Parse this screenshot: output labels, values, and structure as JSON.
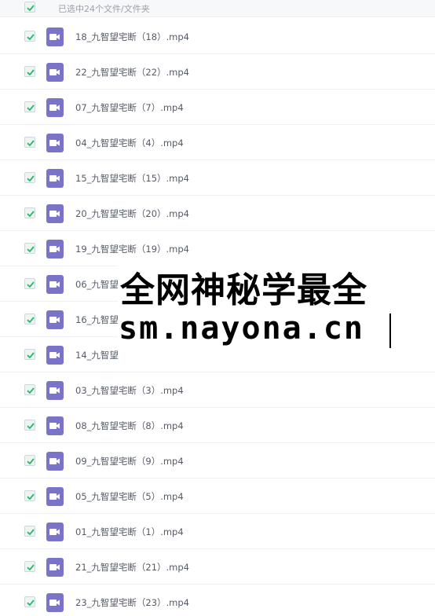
{
  "header": {
    "summary": "已选中24个文件/文件夹",
    "select_all_checked": true
  },
  "files": [
    {
      "name": "18_九智望宅断（18）.mp4",
      "checked": true,
      "icon": "video-file-icon"
    },
    {
      "name": "22_九智望宅断（22）.mp4",
      "checked": true,
      "icon": "video-file-icon"
    },
    {
      "name": "07_九智望宅断（7）.mp4",
      "checked": true,
      "icon": "video-file-icon"
    },
    {
      "name": "04_九智望宅断（4）.mp4",
      "checked": true,
      "icon": "video-file-icon"
    },
    {
      "name": "15_九智望宅断（15）.mp4",
      "checked": true,
      "icon": "video-file-icon"
    },
    {
      "name": "20_九智望宅断（20）.mp4",
      "checked": true,
      "icon": "video-file-icon"
    },
    {
      "name": "19_九智望宅断（19）.mp4",
      "checked": true,
      "icon": "video-file-icon"
    },
    {
      "name": "06_九智望",
      "checked": true,
      "icon": "video-file-icon"
    },
    {
      "name": "16_九智望",
      "checked": true,
      "icon": "video-file-icon"
    },
    {
      "name": "14_九智望",
      "checked": true,
      "icon": "video-file-icon"
    },
    {
      "name": "03_九智望宅断（3）.mp4",
      "checked": true,
      "icon": "video-file-icon"
    },
    {
      "name": "08_九智望宅断（8）.mp4",
      "checked": true,
      "icon": "video-file-icon"
    },
    {
      "name": "09_九智望宅断（9）.mp4",
      "checked": true,
      "icon": "video-file-icon"
    },
    {
      "name": "05_九智望宅断（5）.mp4",
      "checked": true,
      "icon": "video-file-icon"
    },
    {
      "name": "01_九智望宅断（1）.mp4",
      "checked": true,
      "icon": "video-file-icon"
    },
    {
      "name": "21_九智望宅断（21）.mp4",
      "checked": true,
      "icon": "video-file-icon"
    },
    {
      "name": "23_九智望宅断（23）.mp4",
      "checked": true,
      "icon": "video-file-icon"
    }
  ],
  "watermark": {
    "line1": "全网神秘学最全",
    "line2": "sm.nayona.cn"
  },
  "colors": {
    "check_green": "#2db36b",
    "video_icon": "#7a74c9"
  }
}
